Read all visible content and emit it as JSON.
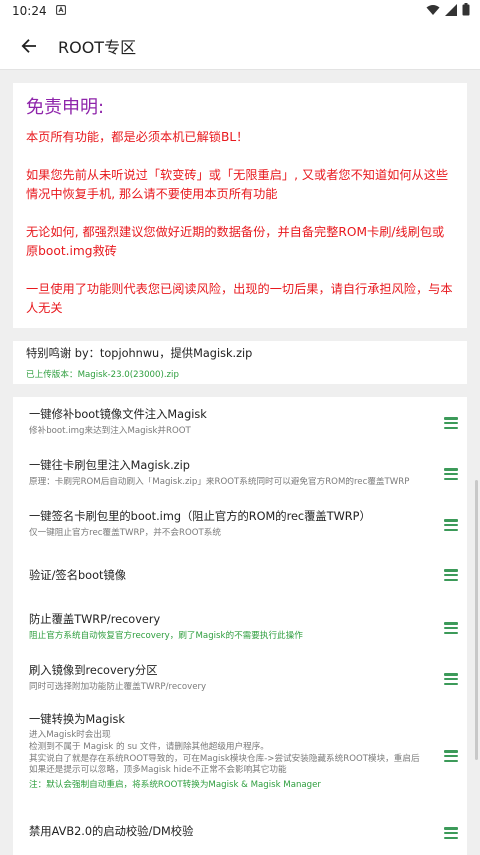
{
  "status": {
    "time": "10:24"
  },
  "header": {
    "title": "ROOT专区"
  },
  "disclaimer": {
    "title": "免责申明:",
    "p1": "本页所有功能，都是必须本机已解锁BL！",
    "p2": "如果您先前从未听说过「软变砖」或「无限重启」, 又或者您不知道如何从这些情况中恢复手机, 那么请不要使用本页所有功能",
    "p3": "无论如何, 都强烈建议您做好近期的数据备份，并自备完整ROM卡刷/线刷包或原boot.img救砖",
    "p4": "一旦使用了功能则代表您已阅读风险，出现的一切后果，请自行承担风险，与本人无关"
  },
  "thanks": {
    "title": "特别鸣谢 by：topjohnwu，提供Magisk.zip",
    "version": "已上传版本：Magisk-23.0(23000).zip"
  },
  "actions": [
    {
      "title": "一键修补boot镜像文件注入Magisk",
      "desc": "修补boot.img来达到注入Magisk并ROOT"
    },
    {
      "title": "一键往卡刷包里注入Magisk.zip",
      "desc": "原理：卡刷完ROM后自动刷入「Magisk.zip」来ROOT系统同时可以避免官方ROM的rec覆盖TWRP"
    },
    {
      "title": "一键签名卡刷包里的boot.img（阻止官方的ROM的rec覆盖TWRP）",
      "desc": "仅一键阻止官方rec覆盖TWRP，并不会ROOT系统"
    },
    {
      "title": "验证/签名boot镜像",
      "desc": ""
    },
    {
      "title": "防止覆盖TWRP/recovery",
      "desc": "阻止官方系统自动恢复官方recovery，刷了Magisk的不需要执行此操作"
    },
    {
      "title": "刷入镜像到recovery分区",
      "desc": "同时可选择附加功能防止覆盖TWRP/recovery"
    },
    {
      "title": "一键转换为Magisk",
      "desc1": "进入Magisk时会出现",
      "desc2": "检测到不属于 Magisk 的 su 文件，请删除其他超级用户程序。",
      "desc3": "其实说白了就是存在系统ROOT导致的，可在Magisk模块仓库->尝试安装隐藏系统ROOT模块，重启后如果还是提示可以忽略，顶多Magisk hide不正常不会影响其它功能",
      "desc4": "注：默认会强制自动重启，将系统ROOT转换为Magisk & Magisk Manager"
    },
    {
      "title": "禁用AVB2.0的启动校验/DM校验",
      "desc": ""
    }
  ]
}
